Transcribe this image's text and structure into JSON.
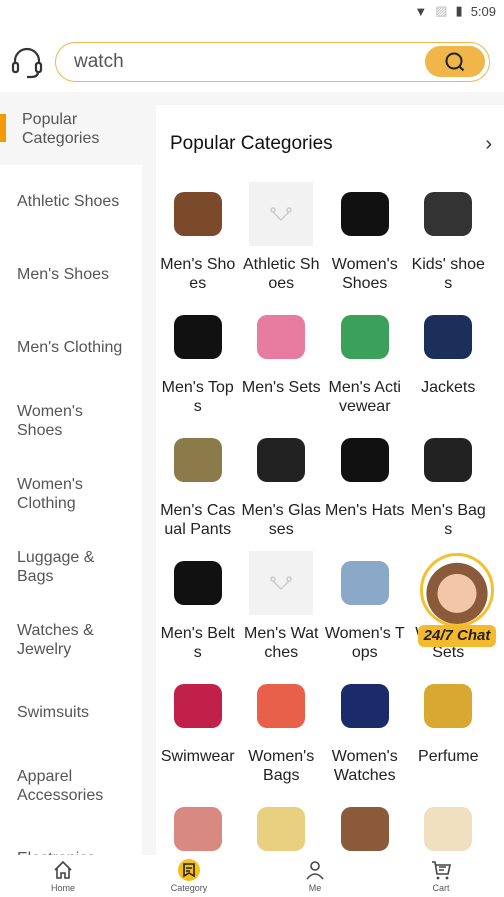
{
  "status": {
    "time": "5:09"
  },
  "search": {
    "value": "watch"
  },
  "sidebar": {
    "items": [
      {
        "label": "Popular Categories",
        "active": true
      },
      {
        "label": "Athletic Shoes"
      },
      {
        "label": "Men's Shoes"
      },
      {
        "label": "Men's Clothing"
      },
      {
        "label": "Women's Shoes"
      },
      {
        "label": "Women's Clothing"
      },
      {
        "label": "Luggage & Bags"
      },
      {
        "label": "Watches & Jewelry"
      },
      {
        "label": "Swimsuits"
      },
      {
        "label": "Apparel Accessories"
      },
      {
        "label": "Electronics"
      }
    ]
  },
  "main": {
    "title": "Popular Categories",
    "categories": [
      {
        "label": "Men's Shoes",
        "color": "#7a4a2a"
      },
      {
        "label": "Athletic Shoes",
        "placeholder": true
      },
      {
        "label": "Women's Shoes",
        "color": "#111"
      },
      {
        "label": "Kids' shoes",
        "color": "#333"
      },
      {
        "label": "Men's Tops",
        "color": "#111"
      },
      {
        "label": "Men's Sets",
        "color": "#e77ca0"
      },
      {
        "label": "Men's Activewear",
        "color": "#3aa05a"
      },
      {
        "label": "Jackets",
        "color": "#1c2f5a"
      },
      {
        "label": "Men's Casual Pants",
        "color": "#8b7a4a"
      },
      {
        "label": "Men's Glasses",
        "color": "#222"
      },
      {
        "label": "Men's Hats",
        "color": "#111"
      },
      {
        "label": "Men's Bags",
        "color": "#222"
      },
      {
        "label": "Men's Belts",
        "color": "#111"
      },
      {
        "label": "Men's Watches",
        "placeholder": true
      },
      {
        "label": "Women's Tops",
        "color": "#8aa8c8"
      },
      {
        "label": "Women's Sets",
        "color": "#ffffff"
      },
      {
        "label": "Swimwear",
        "color": "#c0204a"
      },
      {
        "label": "Women's Bags",
        "color": "#e8604a"
      },
      {
        "label": "Women's Watches",
        "color": "#1a2a6a"
      },
      {
        "label": "Perfume",
        "color": "#d8a830"
      },
      {
        "label": "",
        "color": "#d88a80"
      },
      {
        "label": "",
        "color": "#e8d080"
      },
      {
        "label": "",
        "color": "#8a5a3a"
      },
      {
        "label": "",
        "color": "#f0e0c0"
      }
    ]
  },
  "chat": {
    "label": "24/7 Chat"
  },
  "nav": [
    {
      "label": "Home",
      "icon": "home-icon"
    },
    {
      "label": "Category",
      "icon": "category-icon",
      "active": true
    },
    {
      "label": "Me",
      "icon": "person-icon"
    },
    {
      "label": "Cart",
      "icon": "cart-icon"
    }
  ],
  "colors": {
    "accent": "#f0b64a",
    "active_bar": "#f59b00"
  }
}
